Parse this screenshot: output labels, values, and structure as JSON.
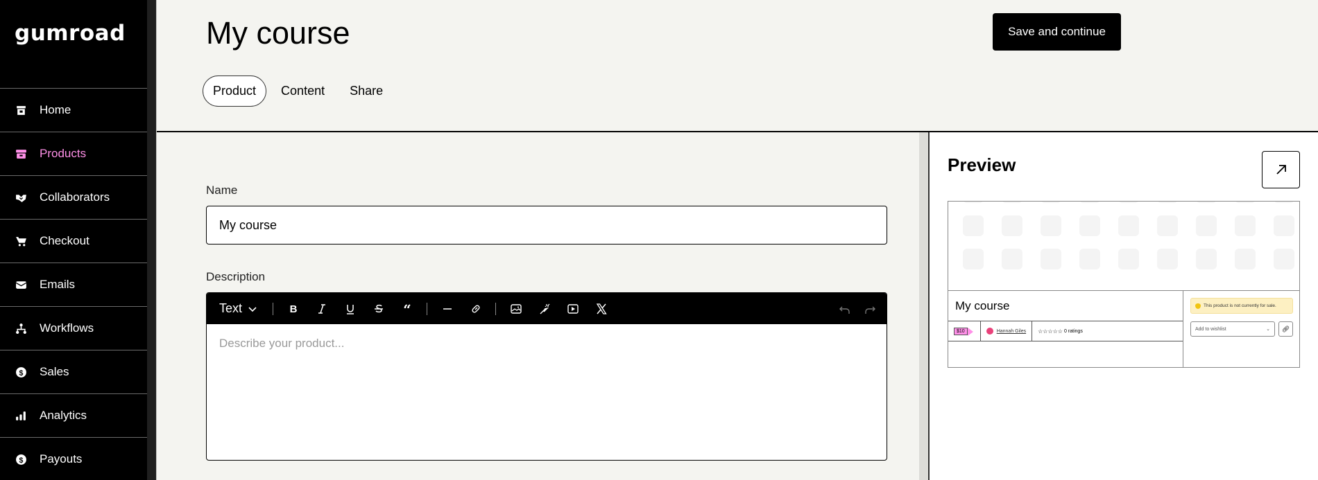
{
  "app": {
    "logo": "gumroad"
  },
  "sidebar": {
    "items": [
      {
        "label": "Home",
        "icon": "store-icon",
        "active": false
      },
      {
        "label": "Products",
        "icon": "archive-box-icon",
        "active": true
      },
      {
        "label": "Collaborators",
        "icon": "handshake-icon",
        "active": false
      },
      {
        "label": "Checkout",
        "icon": "cart-icon",
        "active": false
      },
      {
        "label": "Emails",
        "icon": "envelope-icon",
        "active": false
      },
      {
        "label": "Workflows",
        "icon": "diagram-icon",
        "active": false
      },
      {
        "label": "Sales",
        "icon": "dollar-circle-icon",
        "active": false
      },
      {
        "label": "Analytics",
        "icon": "bar-chart-icon",
        "active": false
      },
      {
        "label": "Payouts",
        "icon": "dollar-circle-icon",
        "active": false
      }
    ],
    "active_color": "#ff90e8"
  },
  "header": {
    "title": "My course",
    "save_label": "Save and continue",
    "tabs": [
      {
        "label": "Product",
        "active": true
      },
      {
        "label": "Content",
        "active": false
      },
      {
        "label": "Share",
        "active": false
      }
    ]
  },
  "form": {
    "name_label": "Name",
    "name_value": "My course",
    "description_label": "Description",
    "description_placeholder": "Describe your product...",
    "toolbar": {
      "text_style": "Text",
      "buttons": [
        "bold",
        "italic",
        "underline",
        "strikethrough",
        "quote",
        "horizontal-rule",
        "link",
        "image",
        "embed",
        "video",
        "x-post"
      ],
      "undo": "undo",
      "redo": "redo"
    }
  },
  "preview": {
    "title": "Preview",
    "card": {
      "name": "My course",
      "price": "$10",
      "author": "Hannah Giles",
      "rating_stars": "☆☆☆☆☆",
      "ratings_text": "0 ratings",
      "notice": "This product is not currently for sale.",
      "wishlist_label": "Add to wishlist"
    }
  }
}
